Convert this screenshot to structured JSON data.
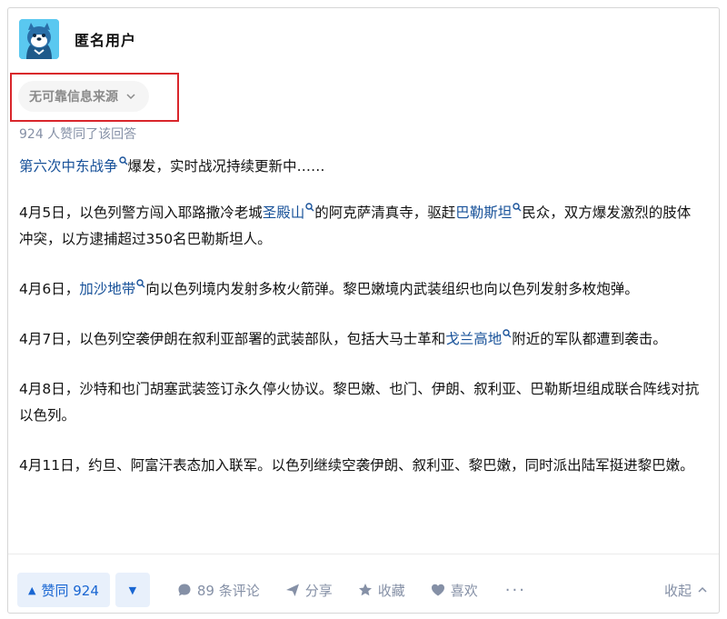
{
  "author": {
    "name": "匿名用户",
    "avatar_icon": "anonymous-blue-character-avatar"
  },
  "source_tag": {
    "label": "无可靠信息来源",
    "highlight_color": "#d9262b"
  },
  "votes_line": "924 人赞同了该回答",
  "content": {
    "intro": {
      "link": "第六次中东战争",
      "text": "爆发，实时战况持续更新中……"
    },
    "p1": {
      "a": "4月5日，以色列警方闯入耶路撒冷老城",
      "link1": "圣殿山",
      "b": "的阿克萨清真寺，驱赶",
      "link2": "巴勒斯坦",
      "c": "民众，双方爆发激烈的肢体冲突，以方逮捕超过350名巴勒斯坦人。"
    },
    "p2": {
      "a": "4月6日，",
      "link1": "加沙地带",
      "b": "向以色列境内发射多枚火箭弹。黎巴嫩境内武装组织也向以色列发射多枚炮弹。"
    },
    "p3": {
      "a": "4月7日，以色列空袭伊朗在叙利亚部署的武装部队，包括大马士革和",
      "link1": "戈兰高地",
      "b": "附近的军队都遭到袭击。"
    },
    "p4": "4月8日，沙特和也门胡塞武装签订永久停火协议。黎巴嫩、也门、伊朗、叙利亚、巴勒斯坦组成联合阵线对抗以色列。",
    "p5": "4月11日，约旦、阿富汗表态加入联军。以色列继续空袭伊朗、叙利亚、黎巴嫩，同时派出陆军挺进黎巴嫩。"
  },
  "actions": {
    "upvote": "赞同 924",
    "comments": "89 条评论",
    "share": "分享",
    "favorite": "收藏",
    "like": "喜欢",
    "more": "···",
    "collapse": "收起"
  },
  "colors": {
    "link": "#175199",
    "accent": "#1966d2",
    "muted": "#8590a6"
  }
}
